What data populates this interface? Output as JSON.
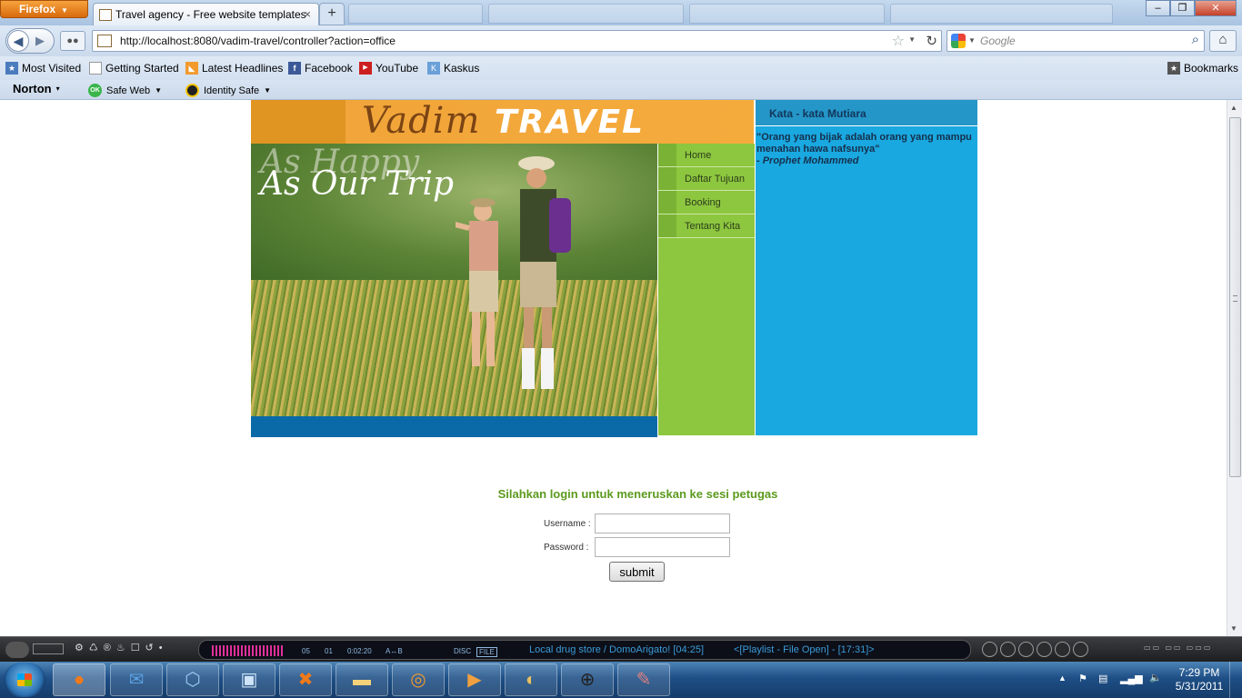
{
  "browser": {
    "app_button": "Firefox",
    "active_tab_title": "Travel agency - Free website templates",
    "url": "http://localhost:8080/vadim-travel/controller?action=office",
    "search_placeholder": "Google"
  },
  "bookmarks": {
    "items": [
      {
        "label": "Most Visited"
      },
      {
        "label": "Getting Started"
      },
      {
        "label": "Latest Headlines"
      },
      {
        "label": "Facebook"
      },
      {
        "label": "YouTube"
      },
      {
        "label": "Kaskus"
      }
    ],
    "right_label": "Bookmarks"
  },
  "norton": {
    "brand": "Norton",
    "safe_web": "Safe Web",
    "identity_safe": "Identity Safe",
    "ok_badge": "OK"
  },
  "site": {
    "logo_vadim": "Vadim",
    "logo_travel": "TRAVEL",
    "hero_line1": "As Happy",
    "hero_line2": "As Our Trip",
    "menu": [
      {
        "label": "Home"
      },
      {
        "label": "Daftar Tujuan"
      },
      {
        "label": "Booking"
      },
      {
        "label": "Tentang Kita"
      }
    ],
    "sidebar_title": "Kata - kata Mutiara",
    "quote": "\"Orang yang bijak adalah orang yang mampu menahan hawa nafsunya\"",
    "quote_author": "- Prophet Mohammed"
  },
  "login": {
    "title": "Silahkan login untuk meneruskan ke sesi petugas",
    "username_label": "Username  :",
    "password_label": "Password  :",
    "username_value": "",
    "password_value": "",
    "submit_label": "submit"
  },
  "player": {
    "track_num": "05",
    "disc_num": "01",
    "time": "0:02:20",
    "ab_label": "A↔B",
    "disc_label": "DISC",
    "file_label": "FILE",
    "now_playing": "Local drug store / DomoArigato!  [04:25]",
    "playlist": "<[Playlist - File Open] - [17:31]>"
  },
  "taskbar": {
    "time": "7:29 PM",
    "date": "5/31/2011"
  },
  "colors": {
    "logo_bg": "#f1a53a",
    "menu_bg": "#8dc63f",
    "sidebar_bg": "#1aa8e0",
    "footer_bar": "#0a6aa8",
    "login_title": "#5c9a1e"
  }
}
